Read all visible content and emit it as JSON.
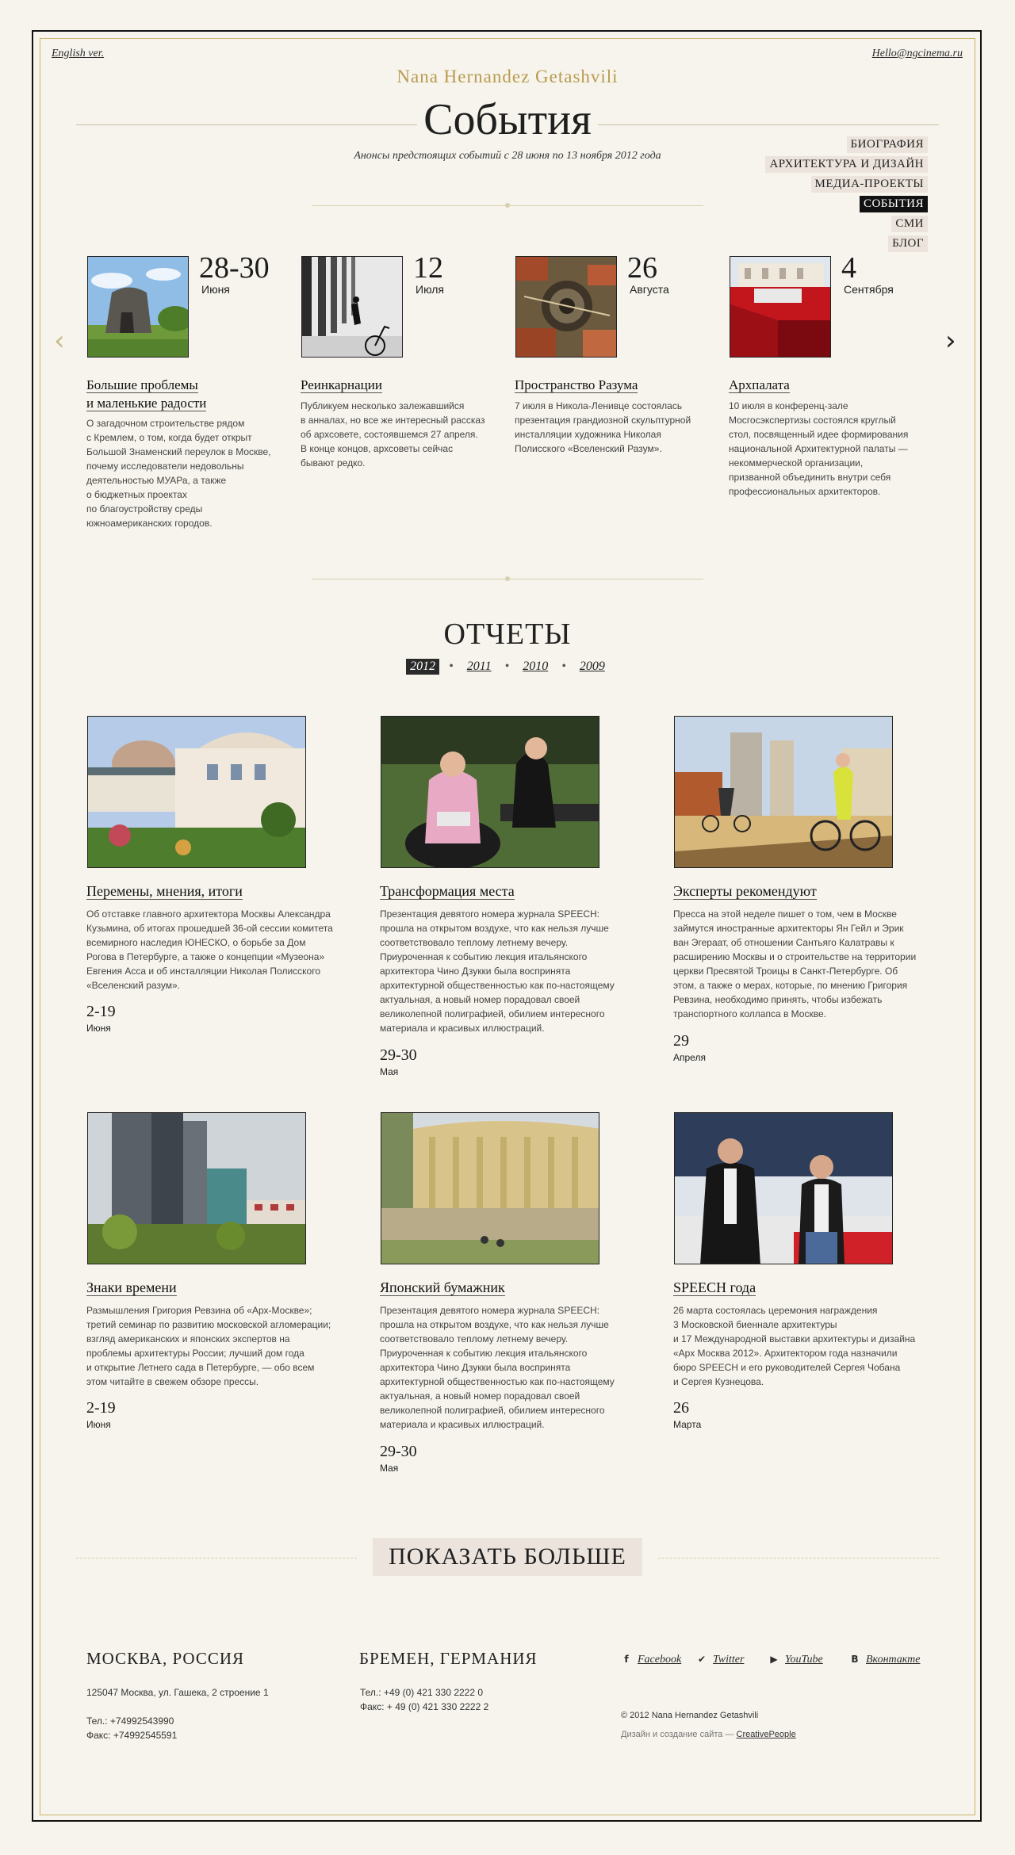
{
  "header": {
    "english_link": "English ver.",
    "email": "Hello@ngcinema.ru",
    "site_name": "Nana Hernandez Getashvili",
    "page_title": "События",
    "subtitle": "Анонсы предстоящих событий с 28 июня по 13 ноября 2012 года"
  },
  "nav": {
    "items": [
      "БИОГРАФИЯ",
      "АРХИТЕКТУРА И ДИЗАЙН",
      "МЕДИА-ПРОЕКТЫ",
      "СОБЫТИЯ",
      "СМИ",
      "БЛОГ"
    ],
    "active": "СОБЫТИЯ"
  },
  "carousel": {
    "prev_icon": "‹",
    "next_icon": "›",
    "events": [
      {
        "day": "28-30",
        "month": "Июня",
        "title_line1": "Большие проблемы",
        "title_line2": "и маленькие радости",
        "text": [
          "О загадочном строительстве рядом",
          "с Кремлем, о том, когда будет открыт",
          "Большой Знаменский переулок в Москве,",
          "почему исследователи недовольны",
          "деятельностью МУАРа, а также",
          "о бюджетных проектах",
          "по благоустройству среды",
          "южноамериканских городов."
        ]
      },
      {
        "day": "12",
        "month": "Июля",
        "title_line1": "Реинкарнации",
        "title_line2": "",
        "text": [
          "Публикуем несколько залежавшийся",
          "в анналах, но все же интересный рассказ",
          "об архсовете, состоявшемся 27 апреля.",
          "В конце концов, архсоветы сейчас",
          "бывают редко."
        ]
      },
      {
        "day": "26",
        "month": "Августа",
        "title_line1": "Пространство Разума",
        "title_line2": "",
        "text": [
          "7 июля в Никола-Ленивце состоялась",
          "презентация грандиозной скульптурной",
          "инсталляции художника Николая",
          "Полисского «Вселенский Разум»."
        ]
      },
      {
        "day": "4",
        "month": "Сентября",
        "title_line1": "Архпалата",
        "title_line2": "",
        "text": [
          "10 июля в конференц-зале",
          "Мосгосэкспертизы состоялся круглый",
          "стол, посвященный идее формирования",
          "национальной Архитектурной палаты —",
          "некоммерческой организации,",
          "призванной объединить внутри себя",
          "профессиональных архитекторов."
        ]
      }
    ]
  },
  "reports": {
    "title": "ОТЧЕТЫ",
    "years": [
      "2012",
      "2011",
      "2010",
      "2009"
    ],
    "separator": "•",
    "active_year": "2012",
    "items": [
      {
        "title": "Перемены, мнения, итоги",
        "text": [
          "Об отставке главного архитектора Москвы Александра",
          "Кузьмина, об итогах прошедшей 36-ой сессии комитета",
          "всемирного наследия ЮНЕСКО, о борьбе за Дом",
          "Рогова в Петербурге, а также о концепции «Музеона»",
          "Евгения Асса и об инсталляции Николая Полисского",
          "«Вселенский разум»."
        ],
        "day": "2-19",
        "month": "Июня"
      },
      {
        "title": "Трансформация места",
        "text": [
          "Презентация девятого номера журнала SPEECH:",
          "прошла на открытом воздухе, что как нельзя лучше",
          "соответствовало теплому летнему вечеру.",
          "Приуроченная к событию лекция итальянского",
          "архитектора Чино Дзукки была воспринята",
          "архитектурной общественностью как по-настоящему",
          "актуальная, а новый номер порадовал своей",
          "великолепной полиграфией, обилием интересного",
          "материала и красивых иллюстраций."
        ],
        "day": "29-30",
        "month": "Мая"
      },
      {
        "title": "Эксперты рекомендуют",
        "text": [
          "Пресса на этой неделе пишет о том, чем в Москве",
          "займутся иностранные архитекторы Ян Гейл и Эрик",
          "ван Эгераат, об отношении Сантьяго Калатравы к",
          "расширению Москвы и о строительстве на территории",
          "церкви Пресвятой Троицы в Санкт-Петербурге. Об",
          "этом, а также о мерах, которые, по мнению Григория",
          "Ревзина, необходимо принять, чтобы избежать",
          "транспортного коллапса в Москве."
        ],
        "day": "29",
        "month": "Апреля"
      },
      {
        "title": "Знаки времени",
        "text": [
          "Размышления Григория Ревзина об «Арх-Москве»;",
          "третий семинар по развитию московской агломерации;",
          "взгляд американских и японских экспертов на",
          "проблемы архитектуры России; лучший дом года",
          "и открытие Летнего сада в Петербурге, — обо всем",
          "этом читайте в свежем обзоре прессы."
        ],
        "day": "2-19",
        "month": "Июня"
      },
      {
        "title": "Японский бумажник",
        "text": [
          "Презентация девятого номера журнала SPEECH:",
          "прошла на открытом воздухе, что как нельзя лучше",
          "соответствовало теплому летнему вечеру.",
          "Приуроченная к событию лекция итальянского",
          "архитектора Чино Дзукки была воспринята",
          "архитектурной общественностью как по-настоящему",
          "актуальная, а новый номер порадовал своей",
          "великолепной полиграфией, обилием интересного",
          "материала и красивых иллюстраций."
        ],
        "day": "29-30",
        "month": "Мая"
      },
      {
        "title": "SPEECH года",
        "text": [
          "26 марта состоялась церемония награждения",
          "3 Московской биеннале архитектуры",
          "и 17 Международной выставки архитектуры и дизайна",
          "«Арх Москва 2012». Архитектором года назначили",
          "бюро SPEECH и его руководителей Сергея Чобана",
          "и Сергея Кузнецова."
        ],
        "day": "26",
        "month": "Марта"
      }
    ]
  },
  "show_more": "ПОКАЗАТЬ БОЛЬШЕ",
  "footer": {
    "moscow": {
      "city": "МОСКВА, РОССИЯ",
      "address": "125047 Москва, ул. Гашека, 2 строение 1",
      "phone": "Тел.: +74992543990",
      "fax": "Факс: +74992545591"
    },
    "bremen": {
      "city": "БРЕМЕН, ГЕРМАНИЯ",
      "phone": "Тел.: +49 (0) 421 330 2222 0",
      "fax": "Факс: + 49 (0) 421 330 2222 2"
    },
    "social": [
      {
        "icon": "f",
        "label": "Facebook"
      },
      {
        "icon": "✔",
        "label": "Twitter"
      },
      {
        "icon": "▶",
        "label": "YouTube"
      },
      {
        "icon": "В",
        "label": "Вконтакте"
      }
    ],
    "copyright": "© 2012 Nana Hernandez Getashvili",
    "credits_prefix": "Дизайн и создание сайта —",
    "credits_link": "CreativePeople"
  },
  "colors": {
    "background": "#f6f4ec",
    "accent_gold": "#b89b4e",
    "nav_bg": "#ece4dc",
    "active_bg": "#111111"
  }
}
